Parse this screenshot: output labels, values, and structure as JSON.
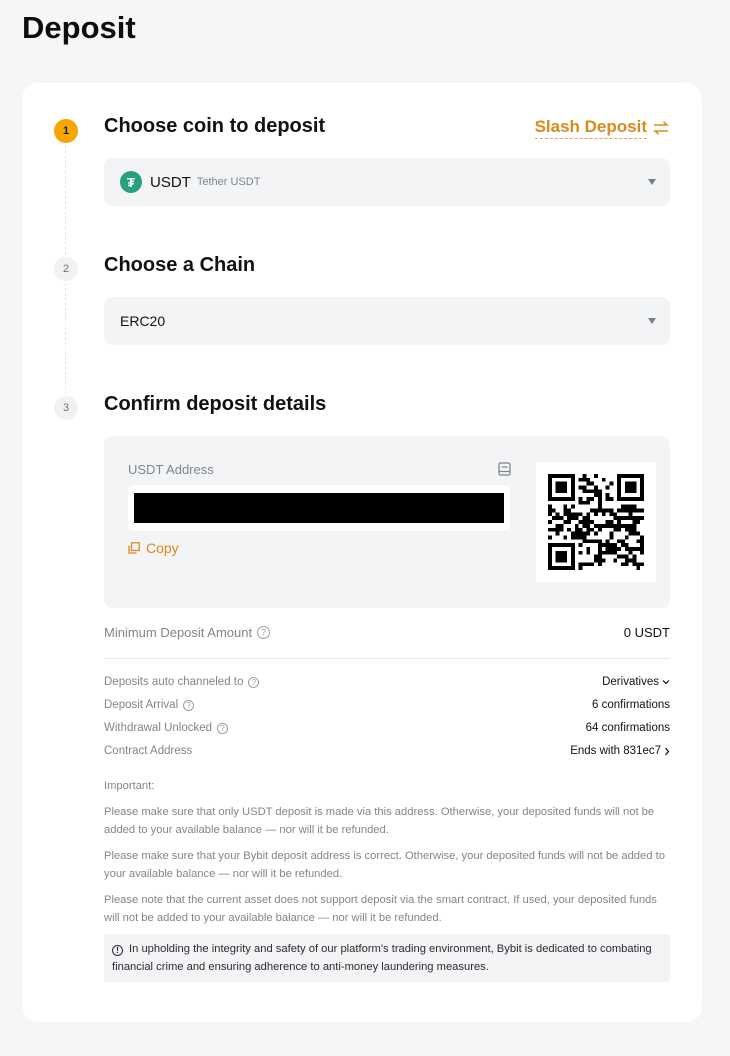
{
  "page": {
    "title": "Deposit"
  },
  "step1": {
    "number": "1",
    "title": "Choose coin to deposit",
    "slash_deposit_label": "Slash Deposit",
    "coin": {
      "symbol": "USDT",
      "name": "Tether USDT",
      "icon_glyph": "₮",
      "icon_color": "#26a17b"
    }
  },
  "step2": {
    "number": "2",
    "title": "Choose a Chain",
    "chain": "ERC20"
  },
  "step3": {
    "number": "3",
    "title": "Confirm deposit details",
    "address_label": "USDT Address",
    "copy_label": "Copy"
  },
  "details": {
    "min_deposit": {
      "label": "Minimum Deposit Amount",
      "value": "0 USDT"
    },
    "channeled": {
      "label": "Deposits auto channeled to",
      "value": "Derivatives"
    },
    "arrival": {
      "label": "Deposit Arrival",
      "value": "6 confirmations"
    },
    "unlocked": {
      "label": "Withdrawal Unlocked",
      "value": "64 confirmations"
    },
    "contract": {
      "label": "Contract Address",
      "value": "Ends with 831ec7"
    }
  },
  "notes": {
    "heading": "Important:",
    "items": [
      "Please make sure that only USDT deposit is made via this address. Otherwise, your deposited funds will not be added to your available balance — nor will it be refunded.",
      "Please make sure that your Bybit deposit address is correct. Otherwise, your deposited funds will not be added to your available balance — nor will it be refunded.",
      "Please note that the current asset does not support deposit via the smart contract. If used, your deposited funds will not be added to your available balance — nor will it be refunded."
    ],
    "alert": "In upholding the integrity and safety of our platform's trading environment, Bybit is dedicated to combating financial crime and ensuring adherence to anti-money laundering measures."
  },
  "colors": {
    "accent": "#f7a600",
    "link": "#d98b1b"
  }
}
